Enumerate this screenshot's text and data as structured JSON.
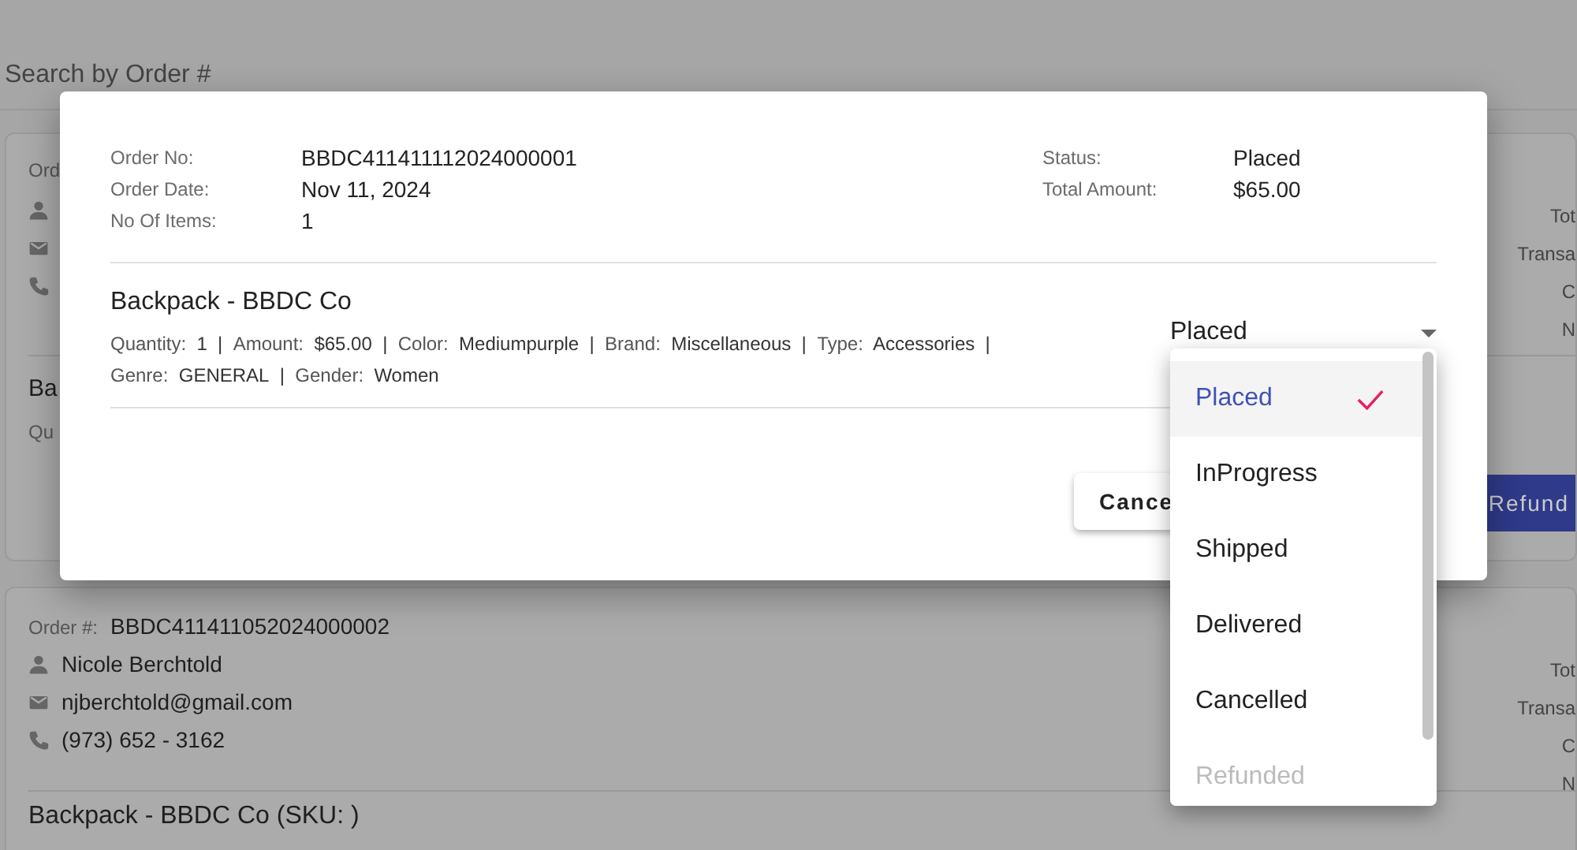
{
  "page": {
    "search_label": "Search by Order #",
    "orders": [
      {
        "order_label": "Ord",
        "item_title": "Ba",
        "item_details": "Qu",
        "right_labels": [
          "Tot",
          "Transa",
          "C",
          "N"
        ],
        "button": "Refund"
      },
      {
        "order_label": "Order #:",
        "order_no": "BBDC411411052024000002",
        "customer": "Nicole Berchtold",
        "email": "njberchtold@gmail.com",
        "phone": "(973) 652 - 3162",
        "item_title": "Backpack - BBDC Co (SKU: )",
        "right_labels": [
          "Tot",
          "Transa",
          "C",
          "N"
        ]
      }
    ]
  },
  "dialog": {
    "left_fields": [
      {
        "label": "Order No:",
        "value": "BBDC411411112024000001"
      },
      {
        "label": "Order Date:",
        "value": "Nov 11, 2024"
      },
      {
        "label": "No Of Items:",
        "value": "1"
      }
    ],
    "right_fields": [
      {
        "label": "Status:",
        "value": "Placed"
      },
      {
        "label": "Total Amount:",
        "value": "$65.00"
      }
    ],
    "item": {
      "title": "Backpack - BBDC Co",
      "separator": "|",
      "attributes": [
        {
          "label": "Quantity:",
          "value": "1"
        },
        {
          "label": "Amount:",
          "value": "$65.00"
        },
        {
          "label": "Color:",
          "value": "Mediumpurple"
        },
        {
          "label": "Brand:",
          "value": "Miscellaneous"
        },
        {
          "label": "Type:",
          "value": "Accessories"
        },
        {
          "label": "Genre:",
          "value": "GENERAL"
        },
        {
          "label": "Gender:",
          "value": "Women"
        }
      ],
      "status_select": {
        "value": "Placed",
        "expanded": true
      }
    },
    "cancel_button": "Cance"
  },
  "status_menu": [
    {
      "label": "Placed",
      "selected": true,
      "disabled": false
    },
    {
      "label": "InProgress",
      "selected": false,
      "disabled": false
    },
    {
      "label": "Shipped",
      "selected": false,
      "disabled": false
    },
    {
      "label": "Delivered",
      "selected": false,
      "disabled": false
    },
    {
      "label": "Cancelled",
      "selected": false,
      "disabled": false
    },
    {
      "label": "Refunded",
      "selected": false,
      "disabled": true
    }
  ]
}
